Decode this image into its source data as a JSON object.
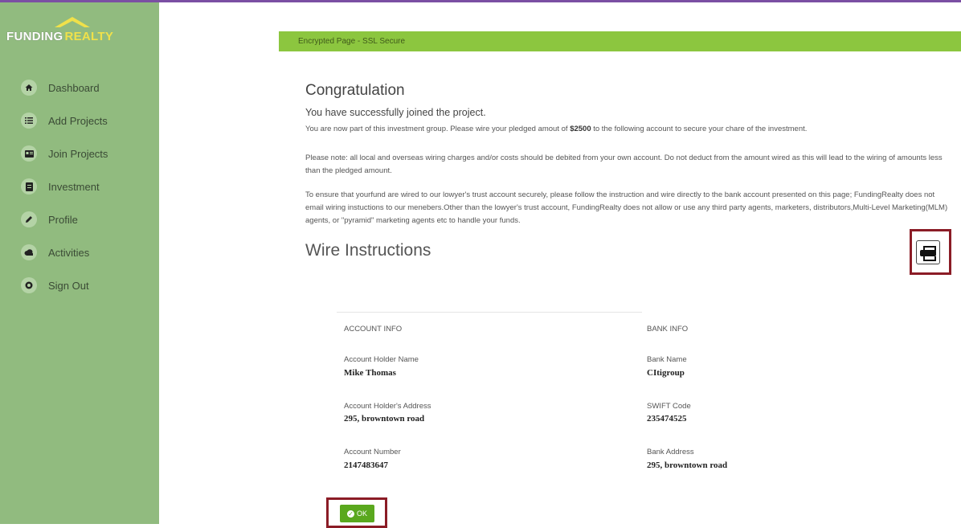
{
  "brand": {
    "part1": "FUNDING",
    "part2": "REALTY"
  },
  "sidebar": {
    "items": [
      {
        "label": "Dashboard",
        "icon": "home-icon"
      },
      {
        "label": "Add Projects",
        "icon": "list-icon"
      },
      {
        "label": "Join Projects",
        "icon": "id-card-icon"
      },
      {
        "label": "Investment",
        "icon": "document-icon"
      },
      {
        "label": "Profile",
        "icon": "pencil-icon"
      },
      {
        "label": "Activities",
        "icon": "cloud-icon"
      },
      {
        "label": "Sign Out",
        "icon": "power-icon"
      }
    ]
  },
  "main": {
    "ssl_banner": "Encrypted Page - SSL Secure",
    "title": "Congratulation",
    "subtitle": "You have successfully joined the project.",
    "para1_pre": "You are now part of this investment group. Please wire your pledged amout of ",
    "amount": "$2500",
    "para1_post": " to the following account to secure your chare of the investment.",
    "para2": "Please note: all local and overseas wiring charges and/or costs should be debited from your own account. Do not deduct from the amount wired as this will lead to the wiring of amounts less than the pledged amount.",
    "para3": "To ensure that yourfund are wired to our lowyer's trust account securely, please follow the instruction and wire directly to the bank account presented on this page; FundingRealty does not email wiring instuctions to our menebers.Other than the lowyer's trust account, FundingRealty does not allow or use any third party agents, marketers, distributors,Multi-Level Marketing(MLM) agents, or \"pyramid\" marketing agents etc to handle your funds.",
    "wire_title": "Wire Instructions"
  },
  "account_info": {
    "heading": "ACCOUNT INFO",
    "holder_name_label": "Account Holder Name",
    "holder_name": "Mike Thomas",
    "holder_address_label": "Account Holder's Address",
    "holder_address": "295, browntown road",
    "number_label": "Account Number",
    "number": "2147483647"
  },
  "bank_info": {
    "heading": "BANK INFO",
    "name_label": "Bank Name",
    "name": "CItigroup",
    "swift_label": "SWIFT Code",
    "swift": "235474525",
    "address_label": "Bank Address",
    "address": "295, browntown road"
  },
  "buttons": {
    "ok_label": "OK"
  },
  "colors": {
    "sidebar": "#91bb7f",
    "ssl_bar": "#8cc63f",
    "ok_button": "#5aa81e",
    "highlight_frame": "#8b1c26",
    "top_border": "#7b4fa3"
  }
}
